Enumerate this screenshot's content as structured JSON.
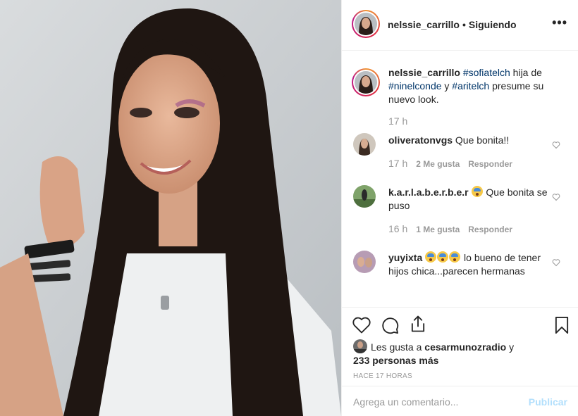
{
  "post": {
    "author": "nelssie_carrillo",
    "separator": "•",
    "follow_status": "Siguiendo",
    "more_label": "•••"
  },
  "caption": {
    "user": "nelssie_carrillo",
    "tag1": "#sofiatelch",
    "text1": " hija de ",
    "tag2": "#ninelconde",
    "text2": " y ",
    "tag3": "#aritelch",
    "text3": " presume su nuevo look.",
    "time": "17 h"
  },
  "comments": [
    {
      "user": "oliveratonvgs",
      "text": " Que bonita!!",
      "emoji_count": 0,
      "time": "17 h",
      "likes": "2 Me gusta",
      "reply": "Responder"
    },
    {
      "user": "k.a.r.l.a.b.e.r.b.e.r",
      "text": " Que bonita se puso",
      "emoji_count": 1,
      "time": "16 h",
      "likes": "1 Me gusta",
      "reply": "Responder"
    },
    {
      "user": "yuyixta",
      "text": " lo bueno de tener hijos chica...parecen hermanas",
      "emoji_count": 3
    }
  ],
  "likes_summary": {
    "prefix": "Les gusta a ",
    "user": "cesarmunozradio",
    "middle": " y ",
    "count": "233 personas más"
  },
  "timestamp": "HACE 17 HORAS",
  "comment_box": {
    "placeholder": "Agrega un comentario...",
    "post_label": "Publicar"
  },
  "colors": {
    "link": "#003569",
    "muted": "#999999",
    "post_disabled": "#b2dffc",
    "border": "#efefef"
  },
  "icons": [
    "more-icon",
    "heart-icon",
    "comment-icon",
    "share-icon",
    "bookmark-icon"
  ]
}
